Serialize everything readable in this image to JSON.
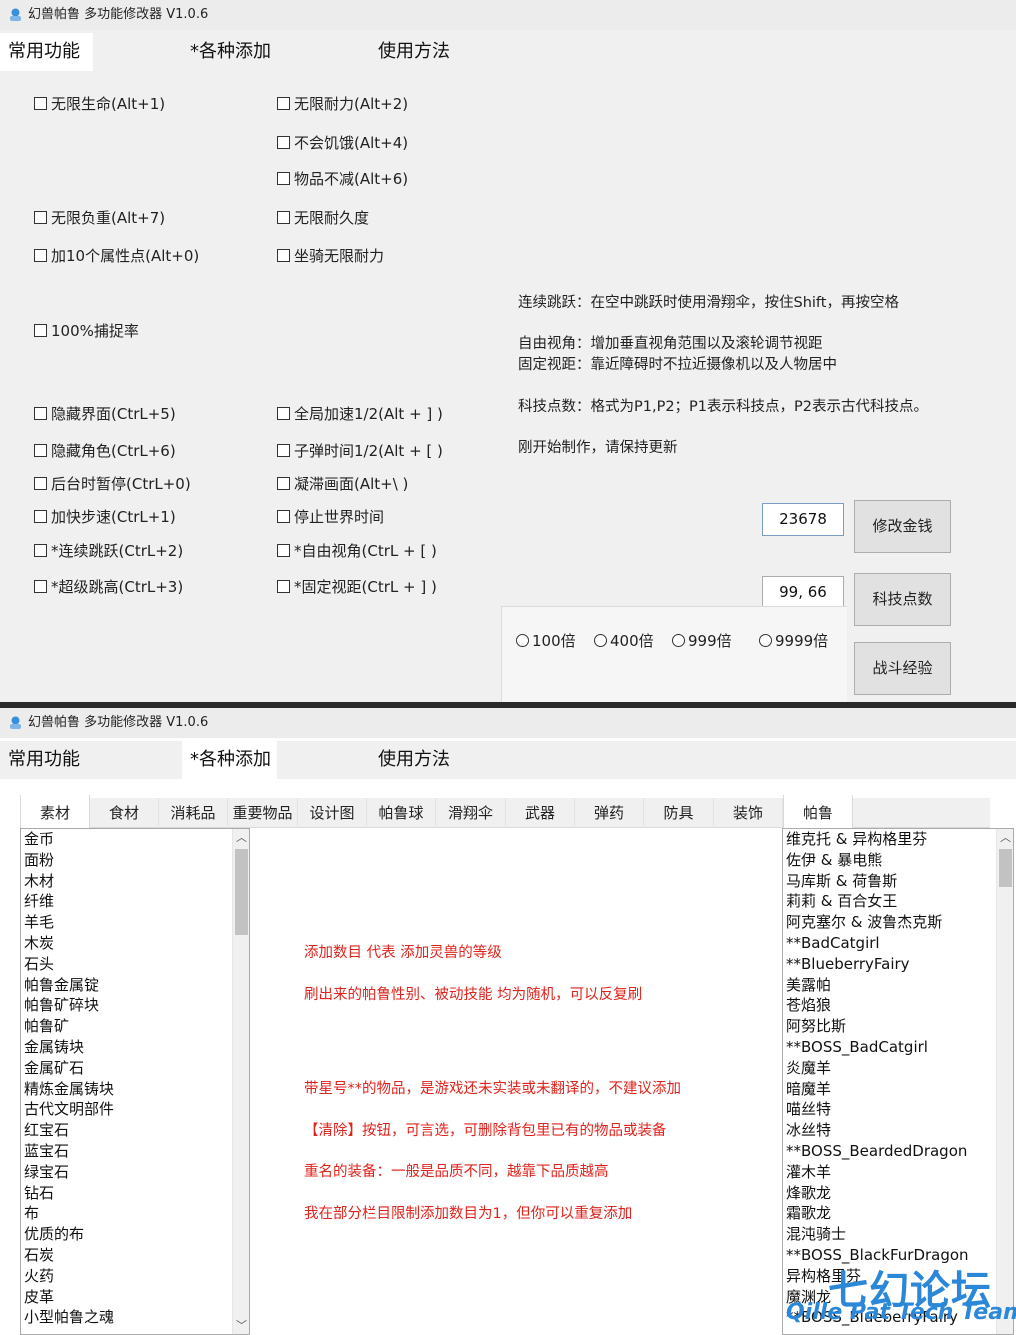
{
  "window1": {
    "title": "幻兽帕鲁 多功能修改器  V1.0.6",
    "tabs": [
      "常用功能",
      "*各种添加",
      "使用方法"
    ],
    "checkboxes": {
      "infinite_health": "无限生命(Alt+1)",
      "infinite_stamina": "无限耐力(Alt+2)",
      "no_hunger": "不会饥饿(Alt+4)",
      "items_no_decrease": "物品不减(Alt+6)",
      "infinite_weight": "无限负重(Alt+7)",
      "infinite_durability": "无限耐久度",
      "add_10_attr_points": "加10个属性点(Alt+0)",
      "mount_infinite_stamina": "坐骑无限耐力",
      "capture_rate_100": "100%捕捉率",
      "hide_ui": "隐藏界面(CtrL+5)",
      "global_speed_half": "全局加速1/2(Alt + ] )",
      "hide_character": "隐藏角色(CtrL+6)",
      "bullet_time_half": "子弹时间1/2(Alt + [ )",
      "background_pause": "后台时暂停(CtrL+0)",
      "freeze_frame": "凝滞画面(Alt+\\ )",
      "fast_steps": "加快步速(CtrL+1)",
      "stop_world_time": "停止世界时间",
      "continuous_jump": "*连续跳跃(CtrL+2)",
      "free_view": "*自由视角(CtrL + [ )",
      "super_jump": "*超级跳高(CtrL+3)",
      "fixed_view": "*固定视距(CtrL + ] )"
    },
    "notes": {
      "jump": "连续跳跃：在空中跳跃时使用滑翔伞，按住Shift，再按空格",
      "free_view": "自由视角：增加垂直视角范围以及滚轮调节视距",
      "fixed_view": "固定视距：靠近障碍时不拉近摄像机以及人物居中",
      "tech": "科技点数：格式为P1,P2；P1表示科技点，P2表示古代科技点。",
      "update": "刚开始制作，请保持更新"
    },
    "money_value": "23678",
    "money_button": "修改金钱",
    "tech_value": "99, 66",
    "tech_button": "科技点数",
    "exp_button": "战斗经验",
    "multipliers": [
      "100倍",
      "400倍",
      "999倍",
      "9999倍"
    ]
  },
  "window2": {
    "title": "幻兽帕鲁 多功能修改器  V1.0.6",
    "tabs": [
      "常用功能",
      "*各种添加",
      "使用方法"
    ],
    "subtabs": [
      "素材",
      "食材",
      "消耗品",
      "重要物品",
      "设计图",
      "帕鲁球",
      "滑翔伞",
      "武器",
      "弹药",
      "防具",
      "装饰",
      "帕鲁"
    ],
    "materials": [
      "金币",
      "面粉",
      "木材",
      "纤维",
      "羊毛",
      "木炭",
      "石头",
      "帕鲁金属锭",
      "帕鲁矿碎块",
      "帕鲁矿",
      "金属铸块",
      "金属矿石",
      "精炼金属铸块",
      "古代文明部件",
      "红宝石",
      "蓝宝石",
      "绿宝石",
      "钻石",
      "布",
      "优质的布",
      "石炭",
      "火药",
      "皮革",
      "小型帕鲁之魂"
    ],
    "pals": [
      "维克托 & 异构格里芬",
      "佐伊 & 暴电熊",
      "马库斯 & 荷鲁斯",
      "莉莉 & 百合女王",
      "阿克塞尔 & 波鲁杰克斯",
      "**BadCatgirl",
      "**BlueberryFairy",
      "美露帕",
      "苍焰狼",
      "阿努比斯",
      "**BOSS_BadCatgirl",
      "炎魔羊",
      "暗魔羊",
      "喵丝特",
      "冰丝特",
      "**BOSS_BeardedDragon",
      "灌木羊",
      "烽歌龙",
      "霜歌龙",
      "混沌骑士",
      "**BOSS_BlackFurDragon",
      "异构格里芬",
      "魔渊龙",
      "**BOSS_BlueberryFairy"
    ],
    "notes": {
      "n1": "添加数目 代表 添加灵兽的等级",
      "n2": "刷出来的帕鲁性别、被动技能 均为随机，可以反复刷",
      "n3": "带星号**的物品，是游戏还未实装或未翻译的，不建议添加",
      "n4": "【清除】按钮，可言选，可删除背包里已有的物品或装备",
      "n5": "重名的装备：一般是品质不同，越靠下品质越高",
      "n6": "我在部分栏目限制添加数目为1，但你可以重复添加"
    },
    "watermark_cn": "七幻论坛",
    "watermark_en": "Qille Pat Tech Team"
  }
}
